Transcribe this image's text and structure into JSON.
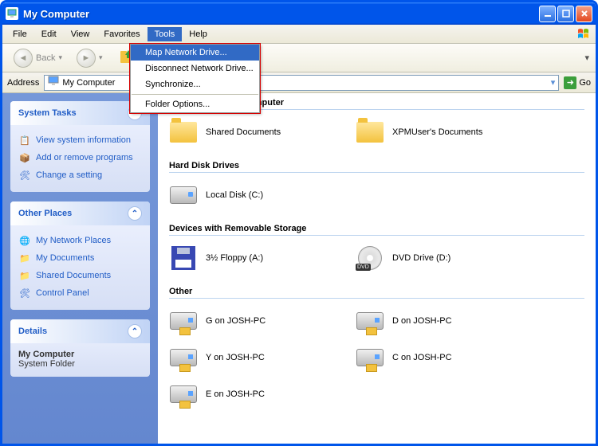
{
  "titlebar": {
    "title": "My Computer"
  },
  "menu": {
    "file": "File",
    "edit": "Edit",
    "view": "View",
    "favorites": "Favorites",
    "tools": "Tools",
    "help": "Help"
  },
  "tools_menu": {
    "map": "Map Network Drive...",
    "disconnect": "Disconnect Network Drive...",
    "sync": "Synchronize...",
    "folder_options": "Folder Options..."
  },
  "toolbar": {
    "back": "Back"
  },
  "addressbar": {
    "label": "Address",
    "value": "My Computer",
    "go": "Go"
  },
  "sidebar": {
    "system_tasks": {
      "title": "System Tasks",
      "view_info": "View system information",
      "add_remove": "Add or remove programs",
      "change_setting": "Change a setting"
    },
    "other_places": {
      "title": "Other Places",
      "network": "My Network Places",
      "documents": "My Documents",
      "shared": "Shared Documents",
      "control_panel": "Control Panel"
    },
    "details": {
      "title": "Details",
      "name": "My Computer",
      "type": "System Folder"
    }
  },
  "groups": {
    "files": {
      "title": "Files Stored on This Computer",
      "shared": "Shared Documents",
      "user_docs": "XPMUser's Documents"
    },
    "hdd": {
      "title": "Hard Disk Drives",
      "local": "Local Disk (C:)"
    },
    "removable": {
      "title": "Devices with Removable Storage",
      "floppy": "3½ Floppy (A:)",
      "dvd": "DVD Drive (D:)"
    },
    "other": {
      "title": "Other",
      "g": "G on JOSH-PC",
      "d": "D on JOSH-PC",
      "y": "Y on JOSH-PC",
      "c": "C on JOSH-PC",
      "e": "E on JOSH-PC"
    }
  }
}
